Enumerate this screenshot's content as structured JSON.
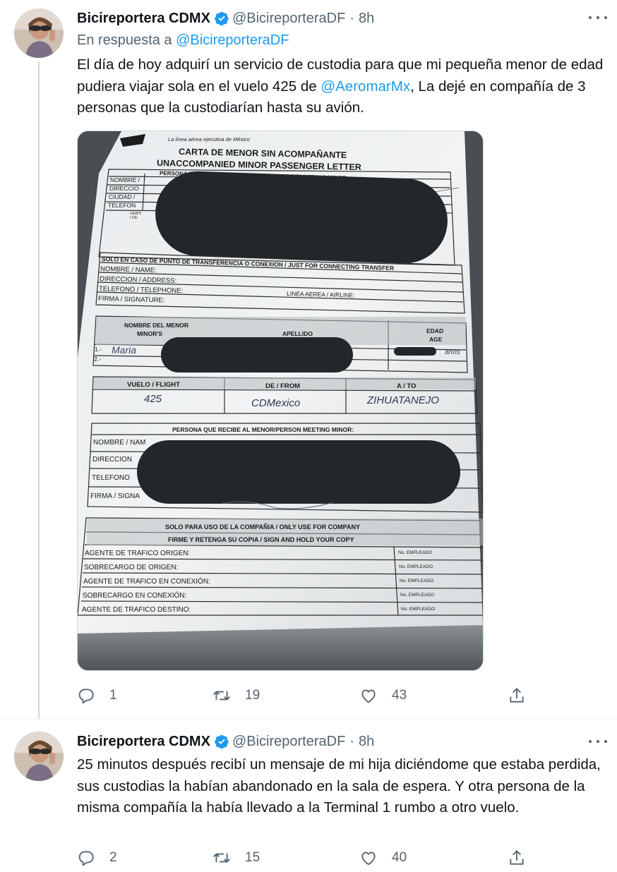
{
  "tweets": [
    {
      "author_name": "Bicireportera CDMX",
      "handle": "@BicireporteraDF",
      "separator": "·",
      "time": "8h",
      "reply_prefix": "En respuesta a",
      "reply_handle": "@BicireporteraDF",
      "text_before_link": "El día de hoy adquirí un servicio de custodia para que mi pequeña menor de edad pudiera viajar sola en el vuelo 425 de ",
      "text_link": "@AeromarMx",
      "text_after_link": ", La dejé en compañía de 3 personas que la custodiarían hasta su avión.",
      "replies": "1",
      "retweets": "19",
      "likes": "43"
    },
    {
      "author_name": "Bicireportera CDMX",
      "handle": "@BicireporteraDF",
      "separator": "·",
      "time": "8h",
      "text": "25 minutos después recibí un mensaje de mi hija diciéndome que estaba perdida, sus custodias la habían abandonado en la sala de espera. Y otra persona de la misma compañía la había llevado a la Terminal 1 rumbo a otro vuelo.",
      "replies": "2",
      "retweets": "15",
      "likes": "40"
    }
  ],
  "document": {
    "airline_tagline": "La línea aérea ejecutiva de México",
    "title_es": "CARTA DE MENOR SIN ACOMPAÑANTE",
    "title_en": "UNACCOMPANIED MINOR PASSENGER LETTER",
    "sec1_header": "PERSONA QUE ENTREGA AL MENOR / PERSON DELIVERING MINOR",
    "sec1_rows": [
      "NOMBRE /",
      "DIRECCIO",
      "CIUDAD /",
      "TELEFON"
    ],
    "sec1_extra": [
      "CERTI",
      "I CE"
    ],
    "sec1_signature": "FIRMA / SIGNATURE",
    "sec2_header": "SOLO EN CASO DE PUNTO DE TRANSFERENCIA O CONEXION / JUST FOR CONNECTING TRANSFER",
    "sec2_rows": [
      "NOMBRE / NAME:",
      "DIRECCION / ADDRESS:",
      "TELEFONO / TELEPHONE:",
      "FIRMA / SIGNATURE:"
    ],
    "sec2_airline": "LINEA AEREA / AIRLINE:",
    "sec3_col1": "NOMBRE DEL MENOR",
    "sec3_col1b": "MINOR'S",
    "sec3_col2": "APELLIDO",
    "sec3_col3": "EDAD",
    "sec3_col3b": "AGE",
    "sec3_rows": [
      "1.-",
      "2.-"
    ],
    "sec3_hand_name": "Maria",
    "sec3_hand_age": "años",
    "flight_col1": "VUELO / FLIGHT",
    "flight_col2": "DE / FROM",
    "flight_col3": "A / TO",
    "flight_no": "425",
    "flight_from": "CDMexico",
    "flight_to": "ZIHUATANEJO",
    "sec5_header": "PERSONA QUE RECIBE AL MENOR/PERSON MEETING MINOR:",
    "sec5_rows": [
      "NOMBRE / NAM",
      "DIRECCION",
      "TELEFONO",
      "FIRMA / SIGNA"
    ],
    "sec6_header": "SOLO PARA USO DE LA COMPAÑIA / ONLY USE FOR COMPANY",
    "sec6_sub": "FIRME  Y RETENGA SU COPIA / SIGN AND HOLD YOUR COPY",
    "sec6_rows": [
      "AGENTE DE TRAFICO ORIGEN:",
      "SOBRECARGO DE ORIGEN:",
      "AGENTE DE TRAFICO EN CONEXIÓN:",
      "SOBRECARGO EN CONEXIÓN:",
      "AGENTE DE TRAFICO DESTINO:"
    ],
    "sec6_employee": "No. EMPLEADO"
  },
  "colors": {
    "link": "#1d9bf0",
    "secondary_text": "#536471",
    "primary_text": "#0f1419",
    "divider": "#eff3f4"
  },
  "icons": [
    "verified-badge-icon",
    "more-options-icon",
    "reply-icon",
    "retweet-icon",
    "like-icon",
    "share-icon"
  ]
}
